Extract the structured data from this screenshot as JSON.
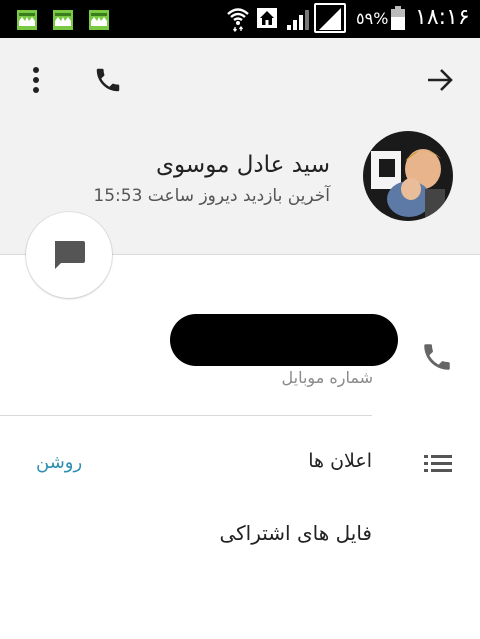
{
  "status_bar": {
    "battery_percent": "٥٩%",
    "time": "١٨:١۶",
    "icons": [
      "app-icon",
      "app-icon",
      "app-icon",
      "wifi-icon",
      "home-icon",
      "signal-icon",
      "signal-icon",
      "battery-icon"
    ],
    "app_icon_color": "#7ac943"
  },
  "header": {
    "icons": [
      "more-vert-icon",
      "phone-icon",
      "arrow-forward-icon"
    ],
    "contact_name": "سید عادل موسوی",
    "last_seen": "آخرین بازدید دیروز ساعت 15:53",
    "background_color": "#f2f2f2"
  },
  "fab": {
    "icon": "message-icon"
  },
  "phone_section": {
    "number_redacted": true,
    "label": "شماره موبایل",
    "icon": "phone-icon"
  },
  "notifications": {
    "label": "اعلان ها",
    "value": "روشن",
    "icon": "list-icon",
    "accent_color": "#2f8fb0"
  },
  "shared_files": {
    "label": "فایل های اشتراکی"
  }
}
